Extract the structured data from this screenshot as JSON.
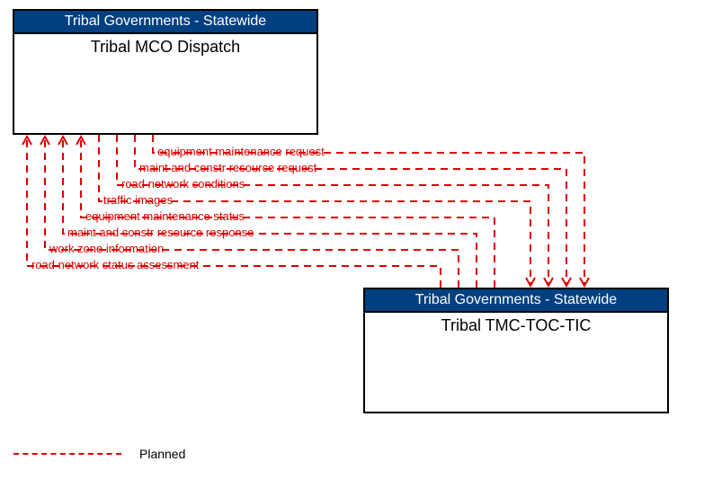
{
  "box1": {
    "header": "Tribal Governments - Statewide",
    "title": "Tribal MCO Dispatch"
  },
  "box2": {
    "header": "Tribal Governments - Statewide",
    "title": "Tribal TMC-TOC-TIC"
  },
  "flows": {
    "f1": "equipment maintenance request",
    "f2": "maint and constr resource request",
    "f3": "road network conditions",
    "f4": "traffic images",
    "f5": "equipment maintenance status",
    "f6": "maint and constr resource response",
    "f7": "work zone information",
    "f8": "road network status assessment"
  },
  "legend": {
    "planned": "Planned"
  }
}
